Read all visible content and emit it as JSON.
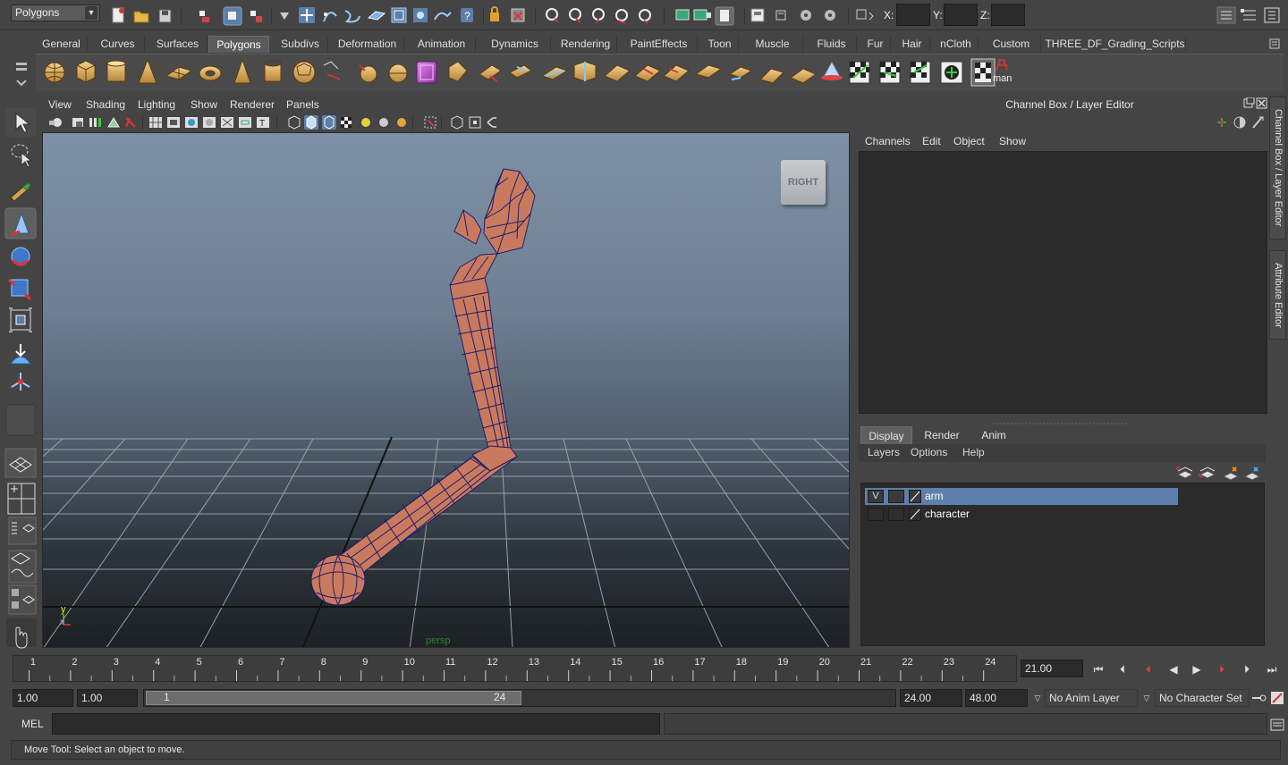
{
  "status_line": {
    "menu_set": "Polygons",
    "x_label": "X:",
    "y_label": "Y:",
    "z_label": "Z:"
  },
  "shelf": {
    "tabs": [
      "General",
      "Curves",
      "Surfaces",
      "Polygons",
      "Subdivs",
      "Deformation",
      "Animation",
      "Dynamics",
      "Rendering",
      "PaintEffects",
      "Toon",
      "Muscle",
      "Fluids",
      "Fur",
      "Hair",
      "nCloth",
      "Custom",
      "THREE_DF_Grading_Scripts"
    ],
    "active_tab": "Polygons",
    "custom_icon_label": "man"
  },
  "viewport": {
    "menu": [
      "View",
      "Shading",
      "Lighting",
      "Show",
      "Renderer",
      "Panels"
    ],
    "view_cube_label": "RIGHT",
    "camera_label": "persp",
    "axis_y": "y",
    "axis_x": "x"
  },
  "channel_box": {
    "title": "Channel Box / Layer Editor",
    "menu": [
      "Channels",
      "Edit",
      "Object",
      "Show"
    ]
  },
  "side_tabs": [
    "Channel Box / Layer Editor",
    "Attribute Editor"
  ],
  "layer_editor": {
    "tabs": [
      "Display",
      "Render",
      "Anim"
    ],
    "active_tab": "Display",
    "menu": [
      "Layers",
      "Options",
      "Help"
    ],
    "layers": [
      {
        "visible": "V",
        "name": "arm",
        "selected": true
      },
      {
        "visible": "",
        "name": "character",
        "selected": false
      }
    ]
  },
  "time_slider": {
    "frames": [
      "1",
      "2",
      "3",
      "4",
      "5",
      "6",
      "7",
      "8",
      "9",
      "10",
      "11",
      "12",
      "13",
      "14",
      "15",
      "16",
      "17",
      "18",
      "19",
      "20",
      "21",
      "22",
      "23",
      "24"
    ],
    "current_frame": "21.00"
  },
  "range_slider": {
    "start_time": "1.00",
    "playback_start": "1.00",
    "range_start_label": "1",
    "range_end_label": "24",
    "playback_end": "24.00",
    "end_time": "48.00",
    "anim_layer": "No Anim Layer",
    "character_set": "No Character Set"
  },
  "command_line": {
    "label": "MEL",
    "value": ""
  },
  "help_line": "Move Tool: Select an object to move.",
  "colors": {
    "accent_selection": "#5d7fab",
    "mesh": "#c97a5e",
    "wire": "#1d1d6a",
    "grid": "#9aa4ad"
  }
}
